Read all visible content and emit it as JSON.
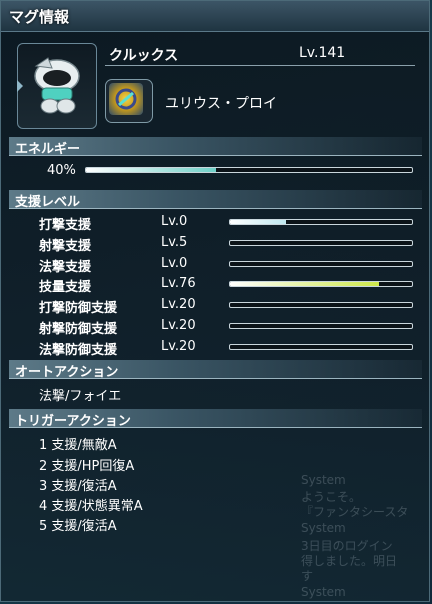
{
  "window": {
    "title": "マグ情報"
  },
  "mag": {
    "name": "クルックス",
    "level": "Lv.141",
    "photon_blast": "ユリウス・プロイ"
  },
  "energy": {
    "heading": "エネルギー",
    "percent_label": "40%",
    "fraction": 0.4
  },
  "support": {
    "heading": "支援レベル",
    "rows": [
      {
        "label": "打撃支援",
        "level": "Lv.0",
        "fill": 0.31,
        "color": "#bfe8f0"
      },
      {
        "label": "射撃支援",
        "level": "Lv.5",
        "fill": 0.0,
        "color": "#bfe8f0"
      },
      {
        "label": "法撃支援",
        "level": "Lv.0",
        "fill": 0.0,
        "color": "#bfe8f0"
      },
      {
        "label": "技量支援",
        "level": "Lv.76",
        "fill": 0.82,
        "color": "#cde84a"
      },
      {
        "label": "打撃防御支援",
        "level": "Lv.20",
        "fill": 0.0,
        "color": "#bfe8f0"
      },
      {
        "label": "射撃防御支援",
        "level": "Lv.20",
        "fill": 0.0,
        "color": "#bfe8f0"
      },
      {
        "label": "法撃防御支援",
        "level": "Lv.20",
        "fill": 0.0,
        "color": "#bfe8f0"
      }
    ]
  },
  "auto_action": {
    "heading": "オートアクション",
    "value": "法撃/フォイエ"
  },
  "trigger_action": {
    "heading": "トリガーアクション",
    "items": [
      "1 支援/無敵A",
      "2 支援/HP回復A",
      "3 支援/復活A",
      "4 支援/状態異常A",
      "5 支援/復活A"
    ]
  },
  "background_chat": [
    "System",
    "ようこそ。",
    "『ファンタシースタ",
    "System",
    "3日目のログイン",
    "得しました。明日",
    "す",
    "System"
  ],
  "colors": {
    "energy_fill": "#6fd0c8",
    "accent": "#9bb4bf"
  }
}
